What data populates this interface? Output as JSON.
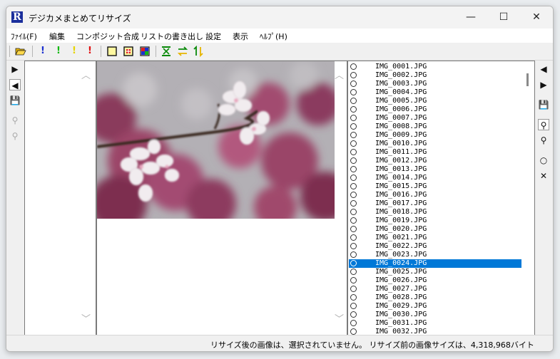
{
  "window": {
    "title": "デジカメまとめてリサイズ",
    "app_icon_letter": "R",
    "minimize_glyph": "—",
    "maximize_glyph": "☐",
    "close_glyph": "✕"
  },
  "menu": [
    "ﾌｧｲﾙ(F)",
    "編集",
    "コンポジット合成",
    "リストの書き出し",
    "設定",
    "表示",
    "ﾍﾙﾌﾟ(H)"
  ],
  "toolbar": {
    "open_icon": "folder-open-icon",
    "marks": [
      "!",
      "!",
      "!",
      "!"
    ],
    "mark_colors": [
      "#1a2fd0",
      "#12b812",
      "#e6d400",
      "#e01010"
    ]
  },
  "left_sidebar": {
    "next_glyph": "▶",
    "prev_glyph": "◀",
    "save_glyph": "💾",
    "zoom_out_glyph": "⚲",
    "zoom_in_glyph": "⚲"
  },
  "right_sidebar": {
    "prev_glyph": "◀",
    "next_glyph": "▶",
    "save_glyph": "💾",
    "zoom_out_glyph": "⚲",
    "zoom_in_glyph": "⚲",
    "mark_glyph": "○",
    "unmark_glyph": "✕"
  },
  "scroll": {
    "up_glyph": "︿",
    "down_glyph": "﹀"
  },
  "files": [
    "IMG_0001.JPG",
    "IMG_0002.JPG",
    "IMG_0003.JPG",
    "IMG_0004.JPG",
    "IMG_0005.JPG",
    "IMG_0006.JPG",
    "IMG_0007.JPG",
    "IMG_0008.JPG",
    "IMG_0009.JPG",
    "IMG_0010.JPG",
    "IMG_0011.JPG",
    "IMG_0012.JPG",
    "IMG_0013.JPG",
    "IMG_0014.JPG",
    "IMG_0015.JPG",
    "IMG_0016.JPG",
    "IMG_0017.JPG",
    "IMG_0018.JPG",
    "IMG_0019.JPG",
    "IMG_0020.JPG",
    "IMG_0021.JPG",
    "IMG_0022.JPG",
    "IMG_0023.JPG",
    "IMG_0024.JPG",
    "IMG_0025.JPG",
    "IMG_0026.JPG",
    "IMG_0027.JPG",
    "IMG_0028.JPG",
    "IMG_0029.JPG",
    "IMG_0030.JPG",
    "IMG_0031.JPG",
    "IMG_0032.JPG"
  ],
  "selected_file": "IMG_0024.JPG",
  "status": {
    "text": "リサイズ後の画像は、選択されていません。 リサイズ前の画像サイズは、4,318,968バイト"
  },
  "colors": {
    "accent": "#0078d7",
    "app_icon_bg": "#1b2f9c"
  }
}
